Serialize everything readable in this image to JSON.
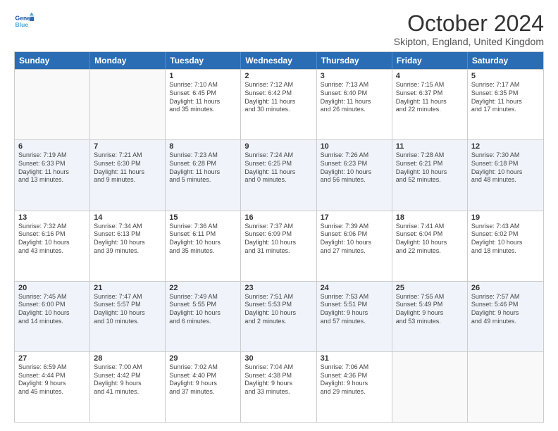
{
  "logo": {
    "text1": "General",
    "text2": "Blue"
  },
  "title": "October 2024",
  "location": "Skipton, England, United Kingdom",
  "days": [
    "Sunday",
    "Monday",
    "Tuesday",
    "Wednesday",
    "Thursday",
    "Friday",
    "Saturday"
  ],
  "rows": [
    [
      {
        "day": "",
        "lines": []
      },
      {
        "day": "",
        "lines": []
      },
      {
        "day": "1",
        "lines": [
          "Sunrise: 7:10 AM",
          "Sunset: 6:45 PM",
          "Daylight: 11 hours",
          "and 35 minutes."
        ]
      },
      {
        "day": "2",
        "lines": [
          "Sunrise: 7:12 AM",
          "Sunset: 6:42 PM",
          "Daylight: 11 hours",
          "and 30 minutes."
        ]
      },
      {
        "day": "3",
        "lines": [
          "Sunrise: 7:13 AM",
          "Sunset: 6:40 PM",
          "Daylight: 11 hours",
          "and 26 minutes."
        ]
      },
      {
        "day": "4",
        "lines": [
          "Sunrise: 7:15 AM",
          "Sunset: 6:37 PM",
          "Daylight: 11 hours",
          "and 22 minutes."
        ]
      },
      {
        "day": "5",
        "lines": [
          "Sunrise: 7:17 AM",
          "Sunset: 6:35 PM",
          "Daylight: 11 hours",
          "and 17 minutes."
        ]
      }
    ],
    [
      {
        "day": "6",
        "lines": [
          "Sunrise: 7:19 AM",
          "Sunset: 6:33 PM",
          "Daylight: 11 hours",
          "and 13 minutes."
        ]
      },
      {
        "day": "7",
        "lines": [
          "Sunrise: 7:21 AM",
          "Sunset: 6:30 PM",
          "Daylight: 11 hours",
          "and 9 minutes."
        ]
      },
      {
        "day": "8",
        "lines": [
          "Sunrise: 7:23 AM",
          "Sunset: 6:28 PM",
          "Daylight: 11 hours",
          "and 5 minutes."
        ]
      },
      {
        "day": "9",
        "lines": [
          "Sunrise: 7:24 AM",
          "Sunset: 6:25 PM",
          "Daylight: 11 hours",
          "and 0 minutes."
        ]
      },
      {
        "day": "10",
        "lines": [
          "Sunrise: 7:26 AM",
          "Sunset: 6:23 PM",
          "Daylight: 10 hours",
          "and 56 minutes."
        ]
      },
      {
        "day": "11",
        "lines": [
          "Sunrise: 7:28 AM",
          "Sunset: 6:21 PM",
          "Daylight: 10 hours",
          "and 52 minutes."
        ]
      },
      {
        "day": "12",
        "lines": [
          "Sunrise: 7:30 AM",
          "Sunset: 6:18 PM",
          "Daylight: 10 hours",
          "and 48 minutes."
        ]
      }
    ],
    [
      {
        "day": "13",
        "lines": [
          "Sunrise: 7:32 AM",
          "Sunset: 6:16 PM",
          "Daylight: 10 hours",
          "and 43 minutes."
        ]
      },
      {
        "day": "14",
        "lines": [
          "Sunrise: 7:34 AM",
          "Sunset: 6:13 PM",
          "Daylight: 10 hours",
          "and 39 minutes."
        ]
      },
      {
        "day": "15",
        "lines": [
          "Sunrise: 7:36 AM",
          "Sunset: 6:11 PM",
          "Daylight: 10 hours",
          "and 35 minutes."
        ]
      },
      {
        "day": "16",
        "lines": [
          "Sunrise: 7:37 AM",
          "Sunset: 6:09 PM",
          "Daylight: 10 hours",
          "and 31 minutes."
        ]
      },
      {
        "day": "17",
        "lines": [
          "Sunrise: 7:39 AM",
          "Sunset: 6:06 PM",
          "Daylight: 10 hours",
          "and 27 minutes."
        ]
      },
      {
        "day": "18",
        "lines": [
          "Sunrise: 7:41 AM",
          "Sunset: 6:04 PM",
          "Daylight: 10 hours",
          "and 22 minutes."
        ]
      },
      {
        "day": "19",
        "lines": [
          "Sunrise: 7:43 AM",
          "Sunset: 6:02 PM",
          "Daylight: 10 hours",
          "and 18 minutes."
        ]
      }
    ],
    [
      {
        "day": "20",
        "lines": [
          "Sunrise: 7:45 AM",
          "Sunset: 6:00 PM",
          "Daylight: 10 hours",
          "and 14 minutes."
        ]
      },
      {
        "day": "21",
        "lines": [
          "Sunrise: 7:47 AM",
          "Sunset: 5:57 PM",
          "Daylight: 10 hours",
          "and 10 minutes."
        ]
      },
      {
        "day": "22",
        "lines": [
          "Sunrise: 7:49 AM",
          "Sunset: 5:55 PM",
          "Daylight: 10 hours",
          "and 6 minutes."
        ]
      },
      {
        "day": "23",
        "lines": [
          "Sunrise: 7:51 AM",
          "Sunset: 5:53 PM",
          "Daylight: 10 hours",
          "and 2 minutes."
        ]
      },
      {
        "day": "24",
        "lines": [
          "Sunrise: 7:53 AM",
          "Sunset: 5:51 PM",
          "Daylight: 9 hours",
          "and 57 minutes."
        ]
      },
      {
        "day": "25",
        "lines": [
          "Sunrise: 7:55 AM",
          "Sunset: 5:49 PM",
          "Daylight: 9 hours",
          "and 53 minutes."
        ]
      },
      {
        "day": "26",
        "lines": [
          "Sunrise: 7:57 AM",
          "Sunset: 5:46 PM",
          "Daylight: 9 hours",
          "and 49 minutes."
        ]
      }
    ],
    [
      {
        "day": "27",
        "lines": [
          "Sunrise: 6:59 AM",
          "Sunset: 4:44 PM",
          "Daylight: 9 hours",
          "and 45 minutes."
        ]
      },
      {
        "day": "28",
        "lines": [
          "Sunrise: 7:00 AM",
          "Sunset: 4:42 PM",
          "Daylight: 9 hours",
          "and 41 minutes."
        ]
      },
      {
        "day": "29",
        "lines": [
          "Sunrise: 7:02 AM",
          "Sunset: 4:40 PM",
          "Daylight: 9 hours",
          "and 37 minutes."
        ]
      },
      {
        "day": "30",
        "lines": [
          "Sunrise: 7:04 AM",
          "Sunset: 4:38 PM",
          "Daylight: 9 hours",
          "and 33 minutes."
        ]
      },
      {
        "day": "31",
        "lines": [
          "Sunrise: 7:06 AM",
          "Sunset: 4:36 PM",
          "Daylight: 9 hours",
          "and 29 minutes."
        ]
      },
      {
        "day": "",
        "lines": []
      },
      {
        "day": "",
        "lines": []
      }
    ]
  ]
}
